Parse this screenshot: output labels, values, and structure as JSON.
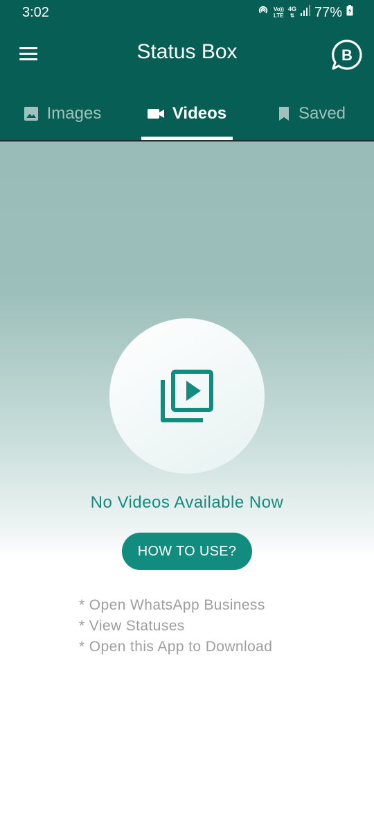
{
  "status_bar": {
    "time": "3:02",
    "net_top": "Vo))",
    "net_bottom": "LTE",
    "gen": "4G",
    "battery": "77%"
  },
  "toolbar": {
    "title": "Status Box",
    "menu_icon": "menu-icon",
    "business_icon": "whatsapp-business-icon"
  },
  "tabs": [
    {
      "label": "Images",
      "icon": "image-icon",
      "active": false
    },
    {
      "label": "Videos",
      "icon": "videocam-icon",
      "active": true
    },
    {
      "label": "Saved",
      "icon": "bookmark-icon",
      "active": false
    }
  ],
  "empty_state": {
    "icon": "video-library-icon",
    "message": "No Videos Available Now",
    "button_label": "HOW TO USE?",
    "instructions": [
      "* Open WhatsApp Business",
      "* View Statuses",
      "* Open this App to Download"
    ]
  },
  "colors": {
    "primary_dark": "#075e54",
    "accent": "#128c7e",
    "instruction_text": "#9e9e9e"
  }
}
